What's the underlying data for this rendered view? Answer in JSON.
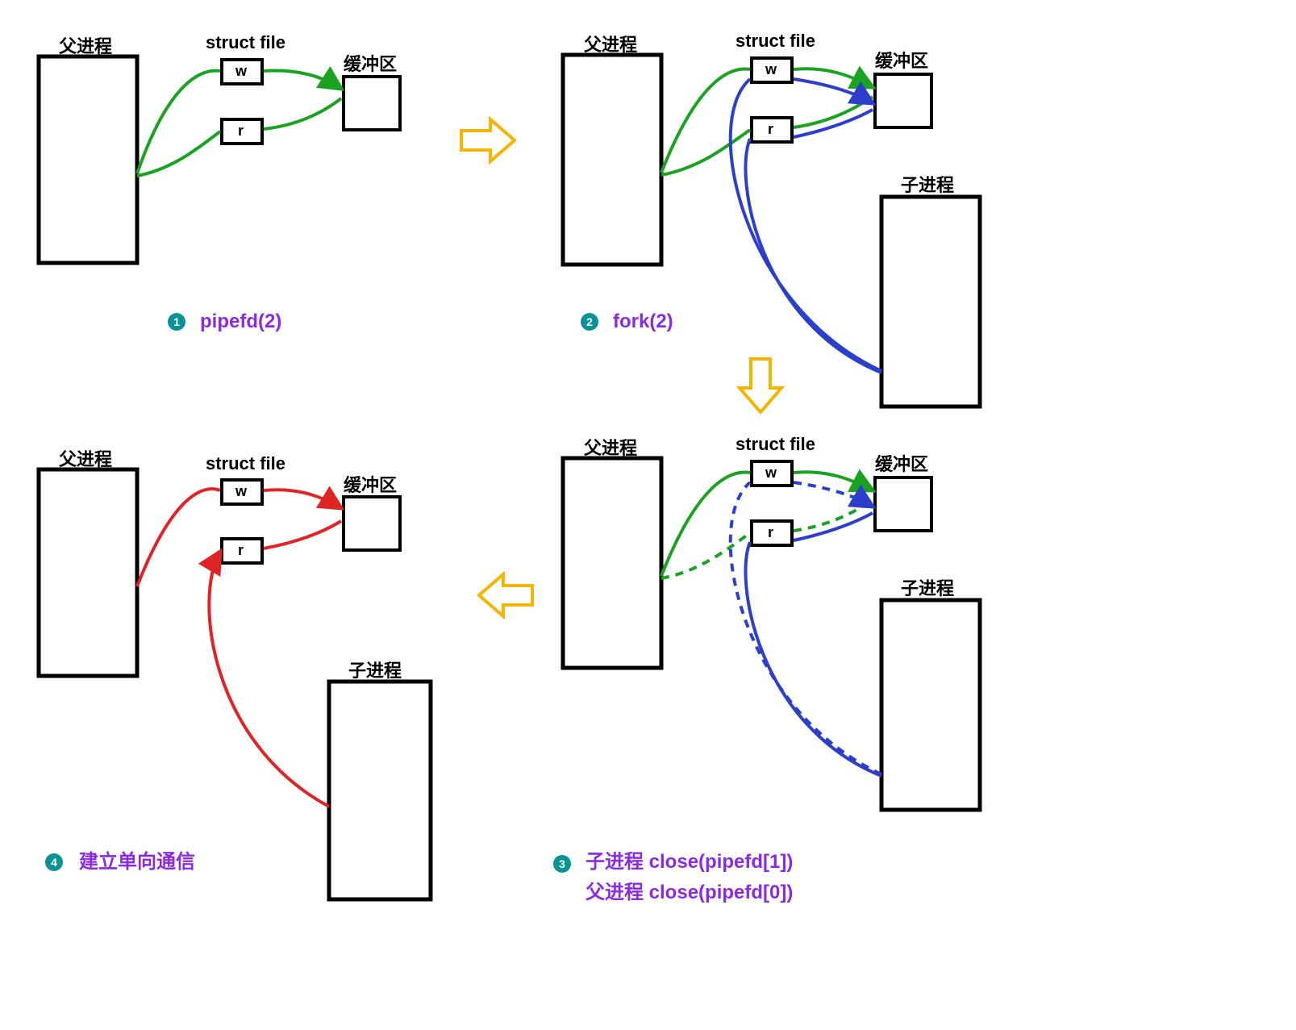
{
  "labels": {
    "parent_process": "父进程",
    "struct_file": "struct file",
    "buffer": "缓冲区",
    "child_process": "子进程",
    "w": "w",
    "r": "r"
  },
  "steps": {
    "1": {
      "num": "1",
      "text": "pipefd(2)"
    },
    "2": {
      "num": "2",
      "text": "fork(2)"
    },
    "3": {
      "num": "3",
      "line1": "子进程 close(pipefd[1])",
      "line2": "父进程 close(pipefd[0])"
    },
    "4": {
      "num": "4",
      "text": "建立单向通信"
    }
  },
  "colors": {
    "green": "#1aa221",
    "blue": "#2b3fcb",
    "red": "#e02424",
    "yellow": "#f4b400",
    "purple": "#8a2be2",
    "badge": "#0a9396"
  }
}
